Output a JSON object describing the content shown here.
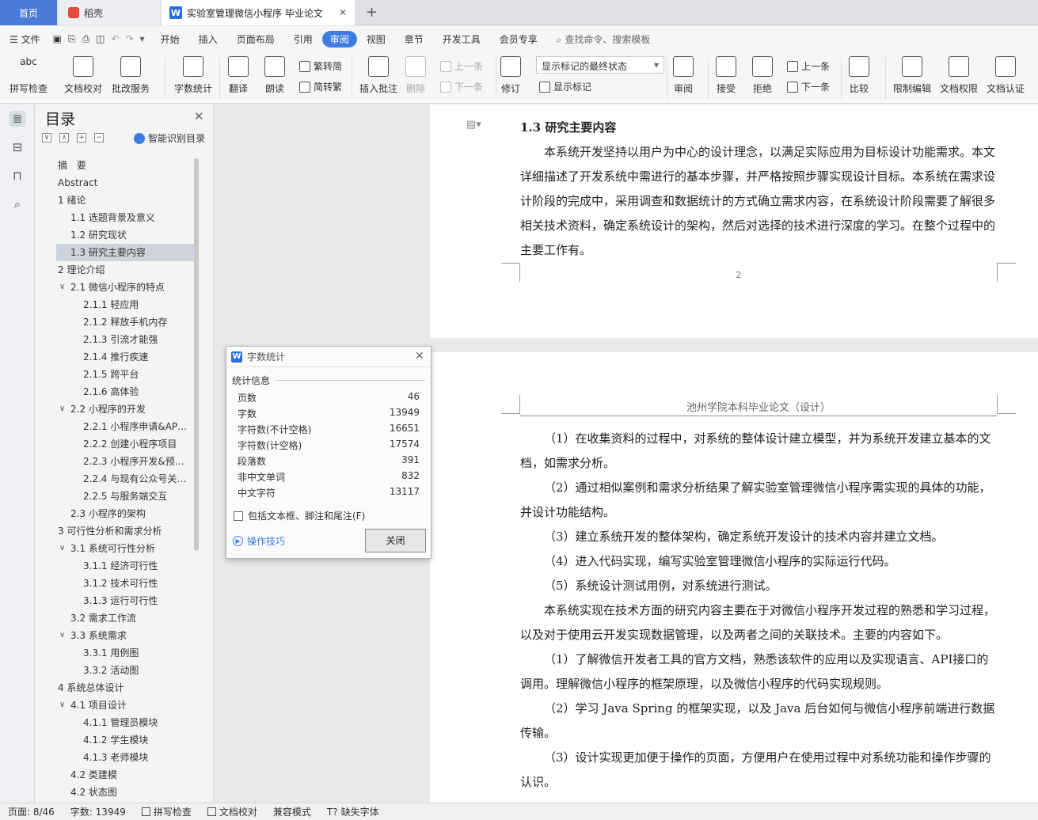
{
  "tabs": {
    "home": "首页",
    "shell": "稻壳",
    "doc": "实验室管理微信小程序 毕业论文",
    "doc_icon": "W",
    "new_tab": "+"
  },
  "menu": {
    "file": "文件",
    "items": [
      "开始",
      "插入",
      "页面布局",
      "引用",
      "审阅",
      "视图",
      "章节",
      "开发工具",
      "会员专享"
    ],
    "search": "查找命令、搜索模板"
  },
  "ribbon": {
    "spell": "拼写检查",
    "proof": "文档校对",
    "annot": "批改服务",
    "wordcount": "字数统计",
    "translate": "翻译",
    "read": "朗读",
    "trad": "繁转简",
    "simp": "简转繁",
    "insert_comment": "插入批注",
    "delete": "删除",
    "prev_comment": "上一条",
    "next_comment": "下一条",
    "track": "修订",
    "markup_state": "显示标记的最终状态",
    "show_markup": "显示标记",
    "review": "审阅",
    "accept": "接受",
    "reject": "拒绝",
    "prev": "上一条",
    "next": "下一条",
    "compare": "比较",
    "restrict": "限制编辑",
    "rights": "文档权限",
    "auth": "文档认证",
    "abc": "abc"
  },
  "outline": {
    "title": "目录",
    "smart": "智能识别目录",
    "items": [
      {
        "label": "摘　要",
        "level": 0,
        "caret": ""
      },
      {
        "label": "Abstract",
        "level": 0,
        "caret": ""
      },
      {
        "label": "1 绪论",
        "level": 0,
        "caret": "∨"
      },
      {
        "label": "1.1 选题背景及意义",
        "level": 1,
        "caret": ""
      },
      {
        "label": "1.2 研究现状",
        "level": 1,
        "caret": ""
      },
      {
        "label": "1.3 研究主要内容",
        "level": 1,
        "caret": "",
        "selected": true
      },
      {
        "label": "2 理论介绍",
        "level": 0,
        "caret": "∨"
      },
      {
        "label": "2.1 微信小程序的特点",
        "level": 1,
        "caret": "∨"
      },
      {
        "label": "2.1.1 轻应用",
        "level": 2,
        "caret": ""
      },
      {
        "label": "2.1.2 释放手机内存",
        "level": 2,
        "caret": ""
      },
      {
        "label": "2.1.3 引流才能强",
        "level": 2,
        "caret": ""
      },
      {
        "label": "2.1.4 推行疾速",
        "level": 2,
        "caret": ""
      },
      {
        "label": "2.1.5 跨平台",
        "level": 2,
        "caret": ""
      },
      {
        "label": "2.1.6 高体验",
        "level": 2,
        "caret": ""
      },
      {
        "label": "2.2 小程序的开发",
        "level": 1,
        "caret": "∨"
      },
      {
        "label": "2.2.1 小程序申请&AP…",
        "level": 2,
        "caret": ""
      },
      {
        "label": "2.2.2 创建小程序项目",
        "level": 2,
        "caret": ""
      },
      {
        "label": "2.2.3 小程序开发&预…",
        "level": 2,
        "caret": ""
      },
      {
        "label": "2.2.4 与现有公众号关…",
        "level": 2,
        "caret": ""
      },
      {
        "label": "2.2.5 与服务端交互",
        "level": 2,
        "caret": ""
      },
      {
        "label": "2.3 小程序的架构",
        "level": 1,
        "caret": ""
      },
      {
        "label": "3 可行性分析和需求分析",
        "level": 0,
        "caret": "∨"
      },
      {
        "label": "3.1 系统可行性分析",
        "level": 1,
        "caret": "∨"
      },
      {
        "label": "3.1.1 经济可行性",
        "level": 2,
        "caret": ""
      },
      {
        "label": "3.1.2 技术可行性",
        "level": 2,
        "caret": ""
      },
      {
        "label": "3.1.3 运行可行性",
        "level": 2,
        "caret": ""
      },
      {
        "label": "3.2 需求工作流",
        "level": 1,
        "caret": ""
      },
      {
        "label": "3.3 系统需求",
        "level": 1,
        "caret": "∨"
      },
      {
        "label": "3.3.1 用例图",
        "level": 2,
        "caret": ""
      },
      {
        "label": "3.3.2 活动图",
        "level": 2,
        "caret": ""
      },
      {
        "label": "4 系统总体设计",
        "level": 0,
        "caret": "∨"
      },
      {
        "label": "4.1 项目设计",
        "level": 1,
        "caret": "∨"
      },
      {
        "label": "4.1.1 管理员模块",
        "level": 2,
        "caret": ""
      },
      {
        "label": "4.1.2 学生模块",
        "level": 2,
        "caret": ""
      },
      {
        "label": "4.1.3 老师模块",
        "level": 2,
        "caret": ""
      },
      {
        "label": "4.2 类建模",
        "level": 1,
        "caret": ""
      },
      {
        "label": "4.2 状态图",
        "level": 1,
        "caret": ""
      }
    ]
  },
  "page1": {
    "heading": "1.3 研究主要内容",
    "para": "本系统开发坚持以用户为中心的设计理念，以满足实际应用为目标设计功能需求。本文详细描述了开发系统中需进行的基本步骤，并严格按照步骤实现设计目标。本系统在需求设计阶段的完成中，采用调查和数据统计的方式确立需求内容，在系统设计阶段需要了解很多相关技术资料，确定系统设计的架构，然后对选择的技术进行深度的学习。在整个过程中的主要工作有。",
    "page_number": "2"
  },
  "page2": {
    "header": "池州学院本科毕业论文（设计）",
    "paras": [
      "（1）在收集资料的过程中，对系统的整体设计建立模型，并为系统开发建立基本的文档，如需求分析。",
      "（2）通过相似案例和需求分析结果了解实验室管理微信小程序需实现的具体的功能，并设计功能结构。",
      "（3）建立系统开发的整体架构，确定系统开发设计的技术内容并建立文档。",
      "（4）进入代码实现，编写实验室管理微信小程序的实际运行代码。",
      "（5）系统设计测试用例，对系统进行测试。",
      "本系统实现在技术方面的研究内容主要在于对微信小程序开发过程的熟悉和学习过程，以及对于使用云开发实现数据管理，以及两者之间的关联技术。主要的内容如下。",
      "（1）了解微信开发者工具的官方文档，熟悉该软件的应用以及实现语言、API接口的调用。理解微信小程序的框架原理，以及微信小程序的代码实现规则。",
      "（2）学习 Java Spring 的框架实现，以及 Java 后台如何与微信小程序前端进行数据传输。",
      "（3）设计实现更加便于操作的页面，方便用户在使用过程中对系统功能和操作步骤的认识。"
    ]
  },
  "dialog": {
    "title": "字数统计",
    "section": "统计信息",
    "rows": [
      {
        "label": "页数",
        "value": "46"
      },
      {
        "label": "字数",
        "value": "13949"
      },
      {
        "label": "字符数(不计空格)",
        "value": "16651"
      },
      {
        "label": "字符数(计空格)",
        "value": "17574"
      },
      {
        "label": "段落数",
        "value": "391"
      },
      {
        "label": "非中文单词",
        "value": "832"
      },
      {
        "label": "中文字符",
        "value": "13117"
      }
    ],
    "checkbox": "包括文本框、脚注和尾注(F)",
    "tips": "操作技巧",
    "close": "关闭"
  },
  "status": {
    "page": "页面: 8/46",
    "words": "字数: 13949",
    "spell": "拼写检查",
    "proof": "文档校对",
    "compat": "兼容模式",
    "missing_font": "缺失字体"
  },
  "colors": {
    "accent": "#3e7ce0",
    "home_tab": "#4a7bd8"
  }
}
